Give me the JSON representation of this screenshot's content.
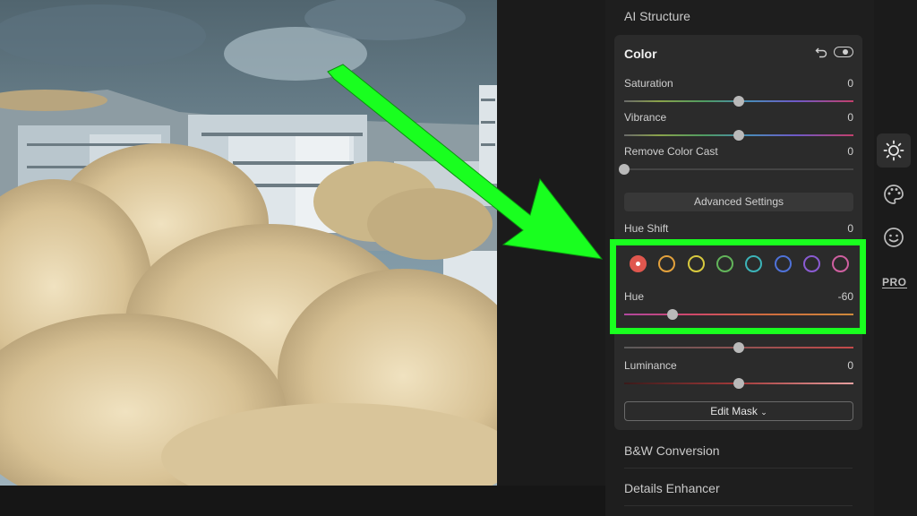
{
  "panel": {
    "ai_structure": "AI Structure",
    "bw_conversion": "B&W Conversion",
    "details_enhancer": "Details Enhancer"
  },
  "color": {
    "title": "Color",
    "sliders": [
      {
        "label": "Saturation",
        "value": "0",
        "position": 0.5
      },
      {
        "label": "Vibrance",
        "value": "0",
        "position": 0.5
      },
      {
        "label": "Remove Color Cast",
        "value": "0",
        "position": 0.0
      }
    ],
    "advanced_settings": "Advanced Settings",
    "hue_shift": {
      "label": "Hue Shift",
      "value": "0"
    },
    "swatch_colors": [
      "#e0574e",
      "#e3a13c",
      "#d8c93e",
      "#62b45a",
      "#3cb3b8",
      "#4f72d9",
      "#8a5bd2",
      "#cf5fa0"
    ],
    "selected_swatch": 0,
    "hue": {
      "label": "Hue",
      "value": "-60",
      "position": 0.21
    },
    "saturation_hidden": {
      "position": 0.5
    },
    "luminance": {
      "label": "Luminance",
      "value": "0",
      "position": 0.5
    },
    "edit_mask": "Edit Mask",
    "edit_mask_chevron": "chevron-down-icon"
  },
  "rail": {
    "pro_label": "PRO",
    "icons": [
      "sun-icon",
      "palette-icon",
      "face-icon"
    ]
  },
  "annotation": {
    "arrow_color": "#19ff1f",
    "box_color": "#19ff1f"
  }
}
